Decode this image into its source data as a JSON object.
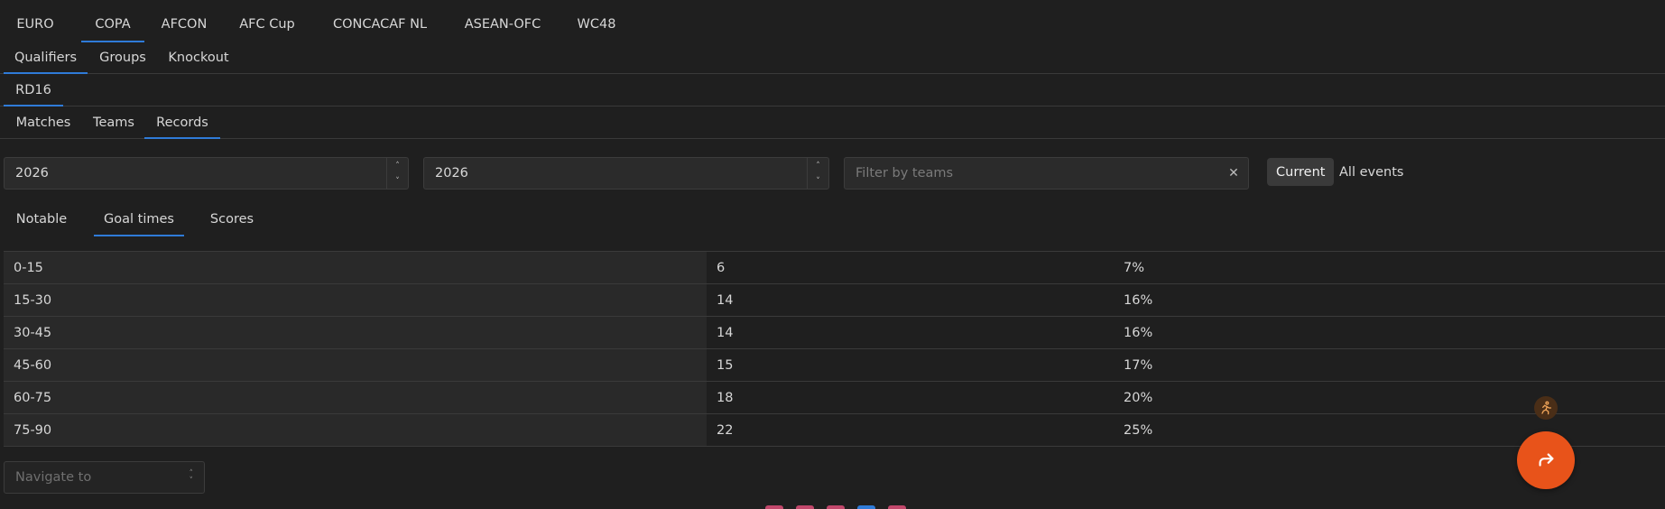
{
  "competitions": [
    "EURO",
    "COPA",
    "AFCON",
    "AFC Cup",
    "CONCACAF NL",
    "ASEAN-OFC",
    "WC48"
  ],
  "stages": [
    "Qualifiers",
    "Groups",
    "Knockout"
  ],
  "rounds": [
    "RD16"
  ],
  "views": [
    "Matches",
    "Teams",
    "Records"
  ],
  "filters": {
    "year_from": "2026",
    "year_to": "2026",
    "team_placeholder": "Filter by teams",
    "current_label": "Current",
    "all_events_label": "All events"
  },
  "record_tabs": [
    "Notable",
    "Goal times",
    "Scores"
  ],
  "goal_times": [
    {
      "range": "0-15",
      "goals": "6",
      "pct": "7%"
    },
    {
      "range": "15-30",
      "goals": "14",
      "pct": "16%"
    },
    {
      "range": "30-45",
      "goals": "14",
      "pct": "16%"
    },
    {
      "range": "45-60",
      "goals": "15",
      "pct": "17%"
    },
    {
      "range": "60-75",
      "goals": "18",
      "pct": "20%"
    },
    {
      "range": "75-90",
      "goals": "22",
      "pct": "25%"
    }
  ],
  "navigate_placeholder": "Navigate to",
  "colors": {
    "accent": "#2f7bd8",
    "fab": "#e8531a",
    "background": "#1f1f1f"
  },
  "icons": {
    "runner": "running-person-icon",
    "fab": "share-arrow-icon",
    "clear": "close-icon"
  }
}
